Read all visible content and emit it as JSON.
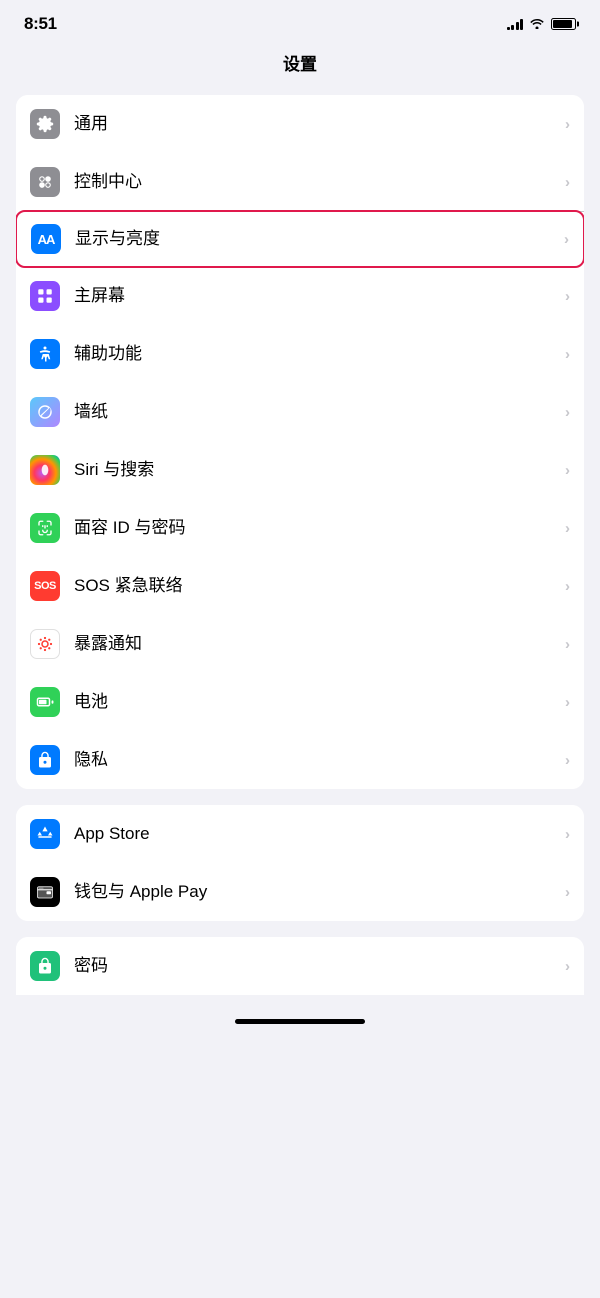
{
  "statusBar": {
    "time": "8:51",
    "signalBars": [
      3,
      6,
      9,
      12
    ],
    "battery": 90
  },
  "pageTitle": "设置",
  "group1": {
    "items": [
      {
        "id": "general",
        "label": "通用",
        "iconType": "gear",
        "iconBg": "gray",
        "highlighted": false
      },
      {
        "id": "control-center",
        "label": "控制中心",
        "iconType": "toggle",
        "iconBg": "gray2",
        "highlighted": false
      },
      {
        "id": "display",
        "label": "显示与亮度",
        "iconType": "aa",
        "iconBg": "blue-aa",
        "highlighted": true
      },
      {
        "id": "home-screen",
        "label": "主屏幕",
        "iconType": "grid",
        "iconBg": "grid",
        "highlighted": false
      },
      {
        "id": "accessibility",
        "label": "辅助功能",
        "iconType": "accessibility",
        "iconBg": "accessibility",
        "highlighted": false
      },
      {
        "id": "wallpaper",
        "label": "墙纸",
        "iconType": "wallpaper",
        "iconBg": "wallpaper",
        "highlighted": false
      },
      {
        "id": "siri",
        "label": "Siri 与搜索",
        "iconType": "siri",
        "iconBg": "siri",
        "highlighted": false
      },
      {
        "id": "faceid",
        "label": "面容 ID 与密码",
        "iconType": "faceid",
        "iconBg": "faceid",
        "highlighted": false
      },
      {
        "id": "sos",
        "label": "SOS 紧急联络",
        "iconType": "sos",
        "iconBg": "sos",
        "highlighted": false
      },
      {
        "id": "exposure",
        "label": "暴露通知",
        "iconType": "exposure",
        "iconBg": "exposure",
        "highlighted": false
      },
      {
        "id": "battery",
        "label": "电池",
        "iconType": "battery",
        "iconBg": "battery",
        "highlighted": false
      },
      {
        "id": "privacy",
        "label": "隐私",
        "iconType": "privacy",
        "iconBg": "privacy",
        "highlighted": false
      }
    ]
  },
  "group2": {
    "items": [
      {
        "id": "appstore",
        "label": "App Store",
        "iconType": "appstore",
        "iconBg": "appstore",
        "highlighted": false
      },
      {
        "id": "wallet",
        "label": "钱包与 Apple Pay",
        "iconType": "wallet",
        "iconBg": "wallet",
        "highlighted": false
      }
    ]
  },
  "group3": {
    "items": [
      {
        "id": "password",
        "label": "密码",
        "iconType": "password",
        "iconBg": "password",
        "highlighted": false
      }
    ]
  },
  "chevron": "›"
}
